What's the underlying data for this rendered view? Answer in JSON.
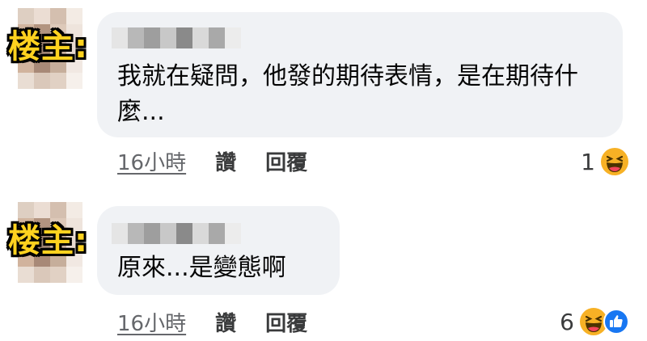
{
  "op_label": "楼主:",
  "comments": [
    {
      "text": "我就在疑問，他發的期待表情，是在期待什麼...",
      "time": "16小時",
      "like_label": "讚",
      "reply_label": "回覆",
      "reaction_count": "1",
      "reactions": [
        "haha-icon"
      ]
    },
    {
      "text": "原來...是變態啊",
      "time": "16小時",
      "like_label": "讚",
      "reply_label": "回覆",
      "reaction_count": "6",
      "reactions": [
        "haha-icon",
        "like-icon"
      ]
    }
  ],
  "colors": {
    "bubble": "#f0f2f5",
    "label_fill": "#ffd21f",
    "like_blue": "#1877f2",
    "haha_yellow": "#f7b125"
  }
}
